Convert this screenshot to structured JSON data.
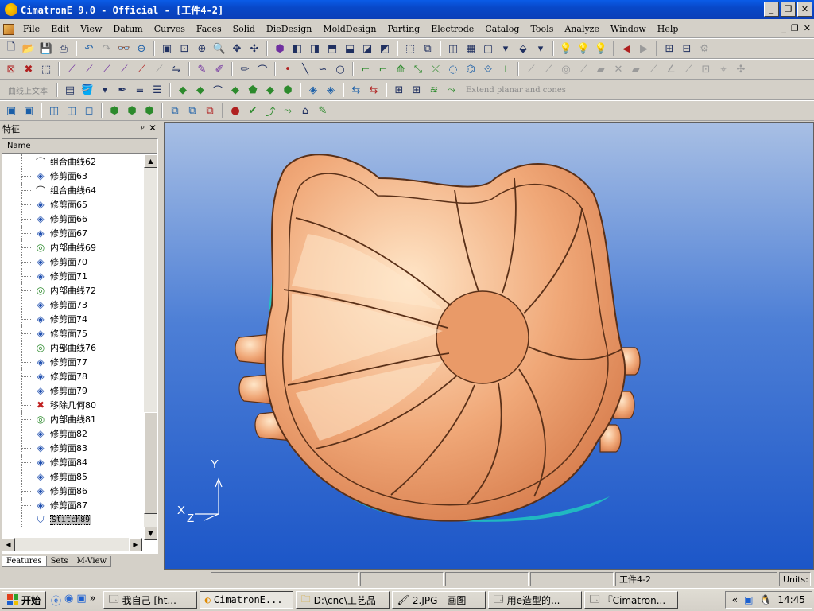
{
  "titlebar": {
    "title": "CimatronE 9.0 - Official - [工件4-2]"
  },
  "menubar": {
    "items": [
      "File",
      "Edit",
      "View",
      "Datum",
      "Curves",
      "Faces",
      "Solid",
      "DieDesign",
      "MoldDesign",
      "Parting",
      "Electrode",
      "Catalog",
      "Tools",
      "Analyze",
      "Window",
      "Help"
    ]
  },
  "toolbar3": {
    "left_text": "曲线上文本",
    "right_text": "Extend planar and cones"
  },
  "panel": {
    "title": "特征",
    "column_header": "Name",
    "rows": [
      {
        "icon": "composite-curve-icon",
        "label": "组合曲线62"
      },
      {
        "icon": "trim-face-icon",
        "label": "修剪面63"
      },
      {
        "icon": "composite-curve-icon",
        "label": "组合曲线64"
      },
      {
        "icon": "trim-face-icon",
        "label": "修剪面65"
      },
      {
        "icon": "trim-face-icon",
        "label": "修剪面66"
      },
      {
        "icon": "trim-face-icon",
        "label": "修剪面67"
      },
      {
        "icon": "inner-curve-icon",
        "label": "内部曲线69"
      },
      {
        "icon": "trim-face-icon",
        "label": "修剪面70"
      },
      {
        "icon": "trim-face-icon",
        "label": "修剪面71"
      },
      {
        "icon": "inner-curve-icon",
        "label": "内部曲线72"
      },
      {
        "icon": "trim-face-icon",
        "label": "修剪面73"
      },
      {
        "icon": "trim-face-icon",
        "label": "修剪面74"
      },
      {
        "icon": "trim-face-icon",
        "label": "修剪面75"
      },
      {
        "icon": "inner-curve-icon",
        "label": "内部曲线76"
      },
      {
        "icon": "trim-face-icon",
        "label": "修剪面77"
      },
      {
        "icon": "trim-face-icon",
        "label": "修剪面78"
      },
      {
        "icon": "trim-face-icon",
        "label": "修剪面79"
      },
      {
        "icon": "remove-geometry-icon",
        "label": "移除几何80"
      },
      {
        "icon": "inner-curve-icon",
        "label": "内部曲线81"
      },
      {
        "icon": "trim-face-icon",
        "label": "修剪面82"
      },
      {
        "icon": "trim-face-icon",
        "label": "修剪面83"
      },
      {
        "icon": "trim-face-icon",
        "label": "修剪面84"
      },
      {
        "icon": "trim-face-icon",
        "label": "修剪面85"
      },
      {
        "icon": "trim-face-icon",
        "label": "修剪面86"
      },
      {
        "icon": "trim-face-icon",
        "label": "修剪面87"
      },
      {
        "icon": "stitch-icon",
        "label": "Stitch89"
      }
    ],
    "tabs": [
      "Features",
      "Sets",
      "M-View"
    ]
  },
  "viewport": {
    "axis_x": "X",
    "axis_y": "Y",
    "axis_z": "Z",
    "model_color": "#f0a878"
  },
  "statusbar": {
    "file": "工件4-2",
    "units": "Units:"
  },
  "taskbar": {
    "start": "开始",
    "tasks": [
      "我自己 [ht...",
      "CimatronE...",
      "D:\\cnc\\工艺品",
      "2.JPG - 画图",
      "用e造型的...",
      "『Cimatron..."
    ],
    "clock": "14:45"
  }
}
